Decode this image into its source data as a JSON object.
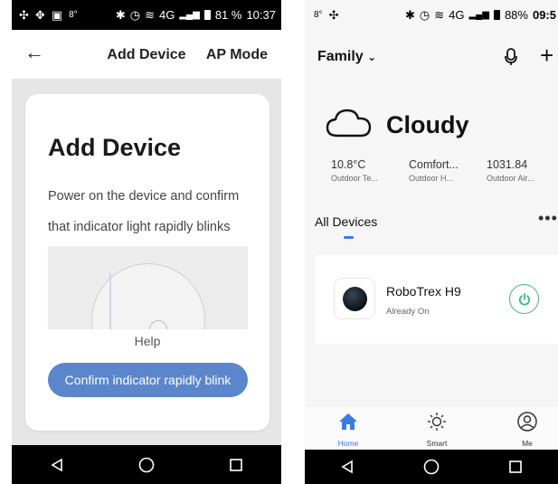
{
  "left": {
    "status": {
      "battery": "81 %",
      "time": "10:37",
      "network": "4G",
      "small_num": "8°"
    },
    "header": {
      "title": "Add Device",
      "ap_mode": "AP Mode"
    },
    "card": {
      "title": "Add Device",
      "description": "Power on the device and confirm that indicator light rapidly blinks",
      "help": "Help",
      "confirm_button": "Confirm indicator rapidly blink"
    }
  },
  "right": {
    "status": {
      "battery": "88%",
      "time": "09:5",
      "network": "4G",
      "small_num": "8°"
    },
    "header": {
      "home_name": "Family"
    },
    "weather": {
      "condition": "Cloudy"
    },
    "stats": [
      {
        "value": "10.8°C",
        "label": "Outdoor Te..."
      },
      {
        "value": "Comfort...",
        "label": "Outdoor H..."
      },
      {
        "value": "1031.84",
        "label": "Outdoor Air..."
      }
    ],
    "devices_tab": "All Devices",
    "device": {
      "name": "RoboTrex H9",
      "status": "Already On"
    },
    "tabs": [
      {
        "label": "Home"
      },
      {
        "label": "Smart"
      },
      {
        "label": "Me"
      }
    ]
  },
  "colors": {
    "accent_blue": "#5b86cb",
    "tab_active": "#3c7be0",
    "power_green": "#3cb77a"
  }
}
